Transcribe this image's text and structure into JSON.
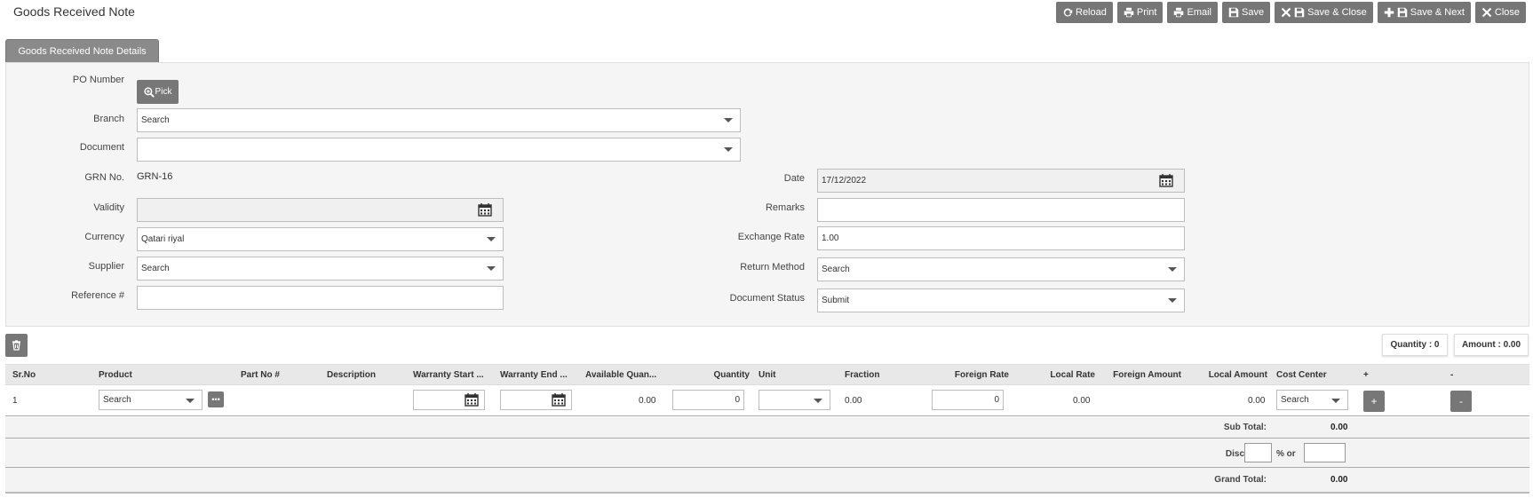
{
  "page": {
    "title": "Goods Received Note"
  },
  "toolbar": {
    "reload": "Reload",
    "print": "Print",
    "email": "Email",
    "save": "Save",
    "save_close": "Save & Close",
    "save_next": "Save & Next",
    "close": "Close"
  },
  "tab": {
    "label": "Goods Received Note Details"
  },
  "form": {
    "po_number_label": "PO Number",
    "pick_label": "Pick",
    "branch_label": "Branch",
    "branch_value": "Search",
    "document_label": "Document",
    "document_value": "",
    "grn_label": "GRN No.",
    "grn_value": "GRN-16",
    "validity_label": "Validity",
    "currency_label": "Currency",
    "currency_value": "Qatari riyal",
    "supplier_label": "Supplier",
    "supplier_value": "Search",
    "reference_label": "Reference #",
    "date_label": "Date",
    "date_value": "17/12/2022",
    "remarks_label": "Remarks",
    "exchange_rate_label": "Exchange Rate",
    "exchange_rate_value": "1.00",
    "return_method_label": "Return Method",
    "return_method_value": "Search",
    "document_status_label": "Document Status",
    "document_status_value": "Submit"
  },
  "summary": {
    "quantity": "Quantity : 0",
    "amount": "Amount : 0.00"
  },
  "grid": {
    "headers": {
      "srno": "Sr.No",
      "product": "Product",
      "part_no": "Part No #",
      "description": "Description",
      "warranty_start": "Warranty Start ...",
      "warranty_end": "Warranty End ...",
      "available_qty": "Available Quan...",
      "quantity": "Quantity",
      "unit": "Unit",
      "fraction": "Fraction",
      "foreign_rate": "Foreign Rate",
      "local_rate": "Local Rate",
      "foreign_amount": "Foreign Amount",
      "local_amount": "Local Amount",
      "cost_center": "Cost Center",
      "add": "+",
      "remove": "-"
    },
    "row": {
      "srno": "1",
      "product": "Search",
      "available_qty": "0.00",
      "quantity": "0",
      "fraction": "0.00",
      "foreign_rate": "0",
      "local_rate": "0.00",
      "local_amount": "0.00",
      "cost_center": "Search",
      "add": "+",
      "remove": "-"
    },
    "totals": {
      "subtotal_label": "Sub Total:",
      "subtotal_value": "0.00",
      "discount_label": "Discount:",
      "discount_or": "% or",
      "grand_total_label": "Grand Total:",
      "grand_total_value": "0.00"
    }
  }
}
